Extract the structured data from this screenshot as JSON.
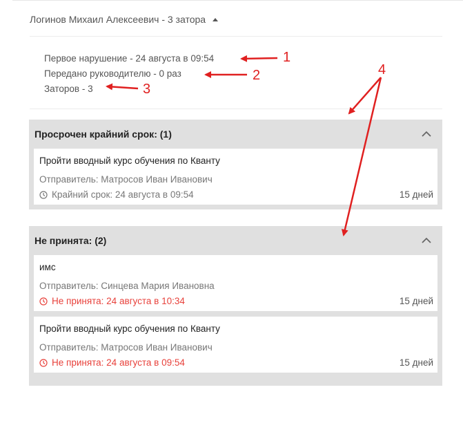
{
  "person": {
    "header_label": "Логинов Михаил Алексеевич - 3 затора"
  },
  "stats": [
    "Первое нарушение - 24 августа в 09:54",
    "Передано руководителю - 0 раз",
    "Заторов - 3"
  ],
  "groups": [
    {
      "title": "Просрочен крайний срок: (1)",
      "tasks": [
        {
          "title": "Пройти вводный курс обучения по Кванту",
          "sender": "Отправитель: Матросов Иван Иванович",
          "status": "Крайний срок: 24 августа в 09:54",
          "days": "15 дней"
        }
      ]
    },
    {
      "title": "Не принята: (2)",
      "tasks": [
        {
          "title": "имс",
          "sender": "Отправитель: Синцева Мария Ивановна",
          "status": "Не принята: 24 августа в 10:34",
          "days": "15 дней"
        },
        {
          "title": "Пройти вводный курс обучения по Кванту",
          "sender": "Отправитель: Матросов Иван Иванович",
          "status": "Не принята: 24 августа в 09:54",
          "days": "15 дней"
        }
      ]
    }
  ],
  "annotations": {
    "color": "#e02020",
    "labels": [
      "1",
      "2",
      "3",
      "4"
    ]
  },
  "colors": {
    "overdue_text": "#e8413b",
    "group_background": "#e0e0e0"
  }
}
